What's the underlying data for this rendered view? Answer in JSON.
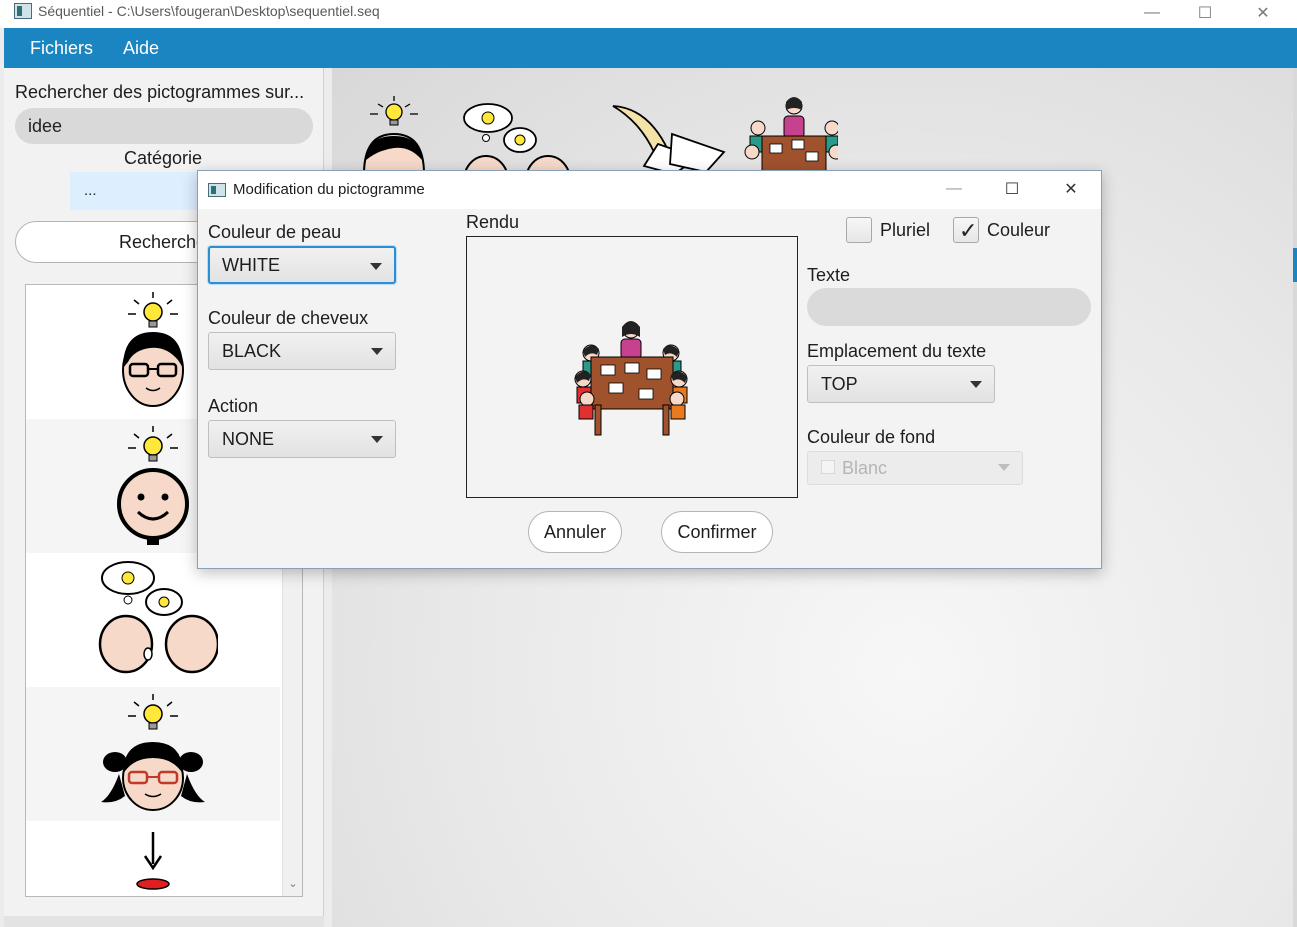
{
  "window": {
    "title": "Séquentiel - C:\\Users\\fougeran\\Desktop\\sequentiel.seq",
    "caption_min": "—",
    "caption_max": "☐",
    "caption_close": "✕"
  },
  "menu": {
    "items": [
      "Fichiers",
      "Aide"
    ]
  },
  "sidebar": {
    "search_label": "Rechercher des pictogrammes sur...",
    "search_value": "idee",
    "category_label": "Catégorie",
    "category_value": "...",
    "search_button": "Recherche"
  },
  "dialog": {
    "title": "Modification du pictogramme",
    "caption_min": "—",
    "caption_max": "☐",
    "caption_close": "✕",
    "skin_label": "Couleur de peau",
    "skin_value": "WHITE",
    "hair_label": "Couleur de cheveux",
    "hair_value": "BLACK",
    "action_label": "Action",
    "action_value": "NONE",
    "render_label": "Rendu",
    "plural_label": "Pluriel",
    "plural_checked": false,
    "color_label": "Couleur",
    "color_checked": true,
    "text_label": "Texte",
    "text_value": "",
    "text_position_label": "Emplacement du texte",
    "text_position_value": "TOP",
    "bg_color_label": "Couleur de fond",
    "bg_color_value": "Blanc",
    "cancel_button": "Annuler",
    "confirm_button": "Confirmer"
  },
  "colors": {
    "menubar": "#1a85c0",
    "focus": "#2a8fd6",
    "table": "#a0522d",
    "bulb": "#ffe83a",
    "skin": "#f6d9c9"
  }
}
